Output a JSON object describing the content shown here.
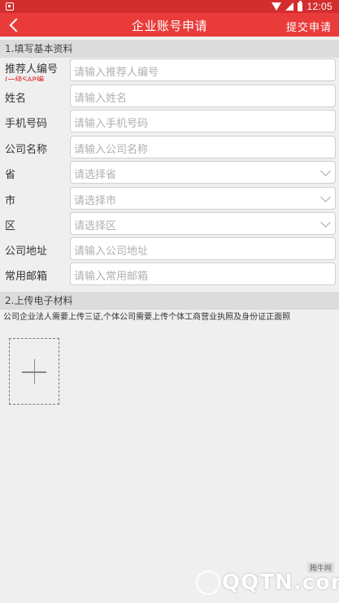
{
  "status_bar": {
    "time": "12:05",
    "icons": [
      "notification-icon",
      "wifi-icon",
      "signal-icon",
      "battery-icon"
    ]
  },
  "app_bar": {
    "title": "企业账号申请",
    "submit_label": "提交申请",
    "back_icon": "chevron-left-icon",
    "color": "#ea3b3b"
  },
  "section1": {
    "title": "1.填写基本资料",
    "fields": [
      {
        "label": "推荐人编号",
        "sub_label": "(一级SAP编",
        "placeholder": "请输入推荐人编号",
        "type": "input"
      },
      {
        "label": "姓名",
        "placeholder": "请输入姓名",
        "type": "input"
      },
      {
        "label": "手机号码",
        "placeholder": "请输入手机号码",
        "type": "input"
      },
      {
        "label": "公司名称",
        "placeholder": "请输入公司名称",
        "type": "input"
      },
      {
        "label": "省",
        "placeholder": "请选择省",
        "type": "select"
      },
      {
        "label": "市",
        "placeholder": "请选择市",
        "type": "select"
      },
      {
        "label": "区",
        "placeholder": "请选择区",
        "type": "select"
      },
      {
        "label": "公司地址",
        "placeholder": "请输入公司地址",
        "type": "input"
      },
      {
        "label": "常用邮箱",
        "placeholder": "请输入常用邮箱",
        "type": "input"
      }
    ]
  },
  "section2": {
    "title": "2.上传电子材料",
    "notice": "公司企业法人需要上传三证,个体公司需要上传个体工商营业执照及身份证正面照",
    "upload_icon": "plus-icon"
  },
  "watermark": {
    "text": "QQTN.com",
    "sub": "腾牛网"
  }
}
